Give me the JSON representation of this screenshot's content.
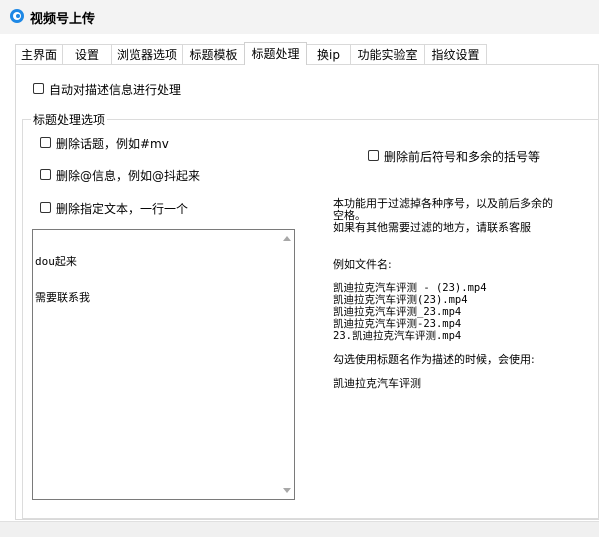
{
  "window": {
    "title": "视频号上传"
  },
  "tabs": [
    {
      "label": "主界面"
    },
    {
      "label": "设置"
    },
    {
      "label": "浏览器选项"
    },
    {
      "label": "标题模板"
    },
    {
      "label": "标题处理"
    },
    {
      "label": "换ip"
    },
    {
      "label": "功能实验室"
    },
    {
      "label": "指纹设置"
    }
  ],
  "active_tab": "标题处理",
  "main": {
    "auto_process_label": "自动对描述信息进行处理",
    "group_title": "标题处理选项",
    "remove_topic_label": "删除话题，例如#mv",
    "remove_mention_label": "删除@信息，例如@抖起来",
    "remove_text_label": "删除指定文本，一行一个",
    "remove_brackets_label": "删除前后符号和多余的括号等",
    "textarea_lines": [
      "dou起来",
      "需要联系我"
    ],
    "info": {
      "line1": "本功能用于过滤掉各种序号，以及前后多余的",
      "line2": "空格。",
      "line3": "如果有其他需要过滤的地方，请联系客服",
      "example_heading": "例如文件名:",
      "examples": [
        "凯迪拉克汽车评测 - (23).mp4",
        "凯迪拉克汽车评测(23).mp4",
        "凯迪拉克汽车评测_23.mp4",
        "凯迪拉克汽车评测-23.mp4",
        "23.凯迪拉克汽车评测.mp4"
      ],
      "usage_note": "勾选使用标题名作为描述的时候，会使用:",
      "result": "凯迪拉克汽车评测"
    }
  }
}
